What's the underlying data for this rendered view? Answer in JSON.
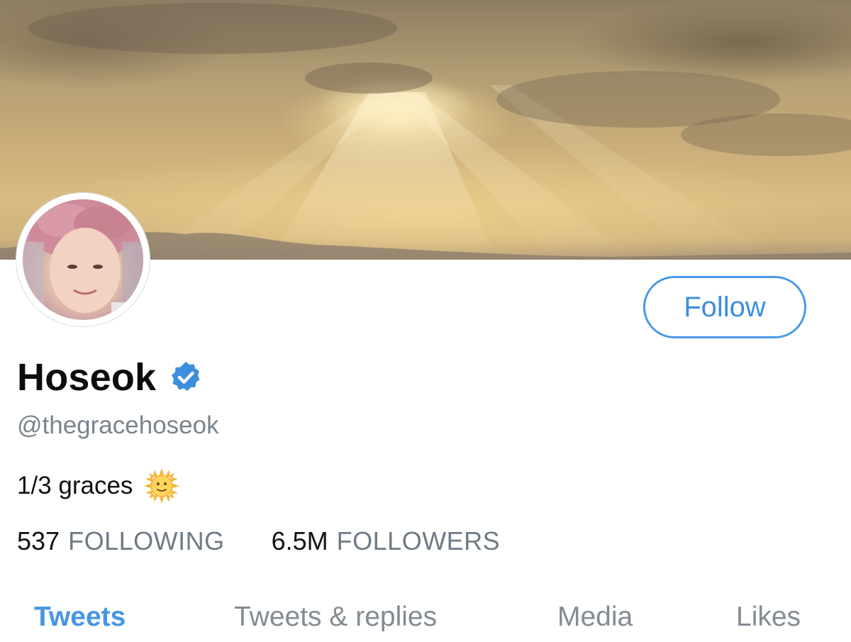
{
  "profile": {
    "display_name": "Hoseok",
    "handle": "@thegracehoseok",
    "bio": "1/3 graces",
    "bio_emoji": "sun-with-face",
    "verified": true
  },
  "follow_button": {
    "label": "Follow"
  },
  "stats": {
    "following_count": "537",
    "following_label": "FOLLOWING",
    "followers_count": "6.5M",
    "followers_label": "FOLLOWERS"
  },
  "tabs": [
    {
      "label": "Tweets",
      "active": true
    },
    {
      "label": "Tweets & replies",
      "active": false
    },
    {
      "label": "Media",
      "active": false
    },
    {
      "label": "Likes",
      "active": false
    }
  ],
  "colors": {
    "accent": "#4a9ae6",
    "verified_badge": "#3d8fdd",
    "muted_text": "#7b838c"
  }
}
